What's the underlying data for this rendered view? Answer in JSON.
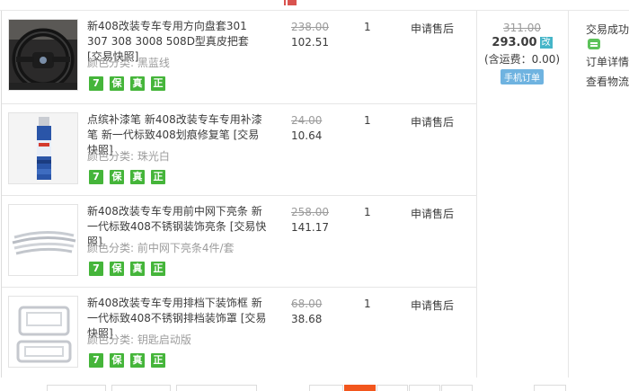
{
  "items": [
    {
      "title": "新408改装专车专用方向盘套301 307 308 3008 508D型真皮把套",
      "snapshot": "[交易快照]",
      "spec_label": "颜色分类:",
      "spec_value": "黑蓝线",
      "original_price": "238.00",
      "price": "102.51",
      "qty": "1",
      "after_sale": "申请售后",
      "thumb_icon": "steering-wheel-cover-image"
    },
    {
      "title": "点缤补漆笔 新408改装专车专用补漆笔 新一代标致408划痕修复笔",
      "snapshot": "[交易快照]",
      "spec_label": "颜色分类:",
      "spec_value": "珠光白",
      "original_price": "24.00",
      "price": "10.64",
      "qty": "1",
      "after_sale": "申请售后",
      "thumb_icon": "touch-up-paint-pen-image"
    },
    {
      "title": "新408改装专车专用前中网下亮条 新一代标致408不锈钢装饰亮条",
      "snapshot": "[交易快照]",
      "spec_label": "颜色分类:",
      "spec_value": "前中网下亮条4件/套",
      "original_price": "258.00",
      "price": "141.17",
      "qty": "1",
      "after_sale": "申请售后",
      "thumb_icon": "chrome-trim-strips-image"
    },
    {
      "title": "新408改装专车专用排档下装饰框 新一代标致408不锈钢排档装饰罩",
      "snapshot": "[交易快照]",
      "spec_label": "颜色分类:",
      "spec_value": "钥匙启动版",
      "original_price": "68.00",
      "price": "38.68",
      "qty": "1",
      "after_sale": "申请售后",
      "thumb_icon": "gear-shift-frame-image"
    }
  ],
  "badges": [
    "7",
    "保",
    "真",
    "正"
  ],
  "badge_icons": [
    "seven-day-return-icon",
    "guarantee-icon",
    "genuine-icon",
    "authentic-icon"
  ],
  "total": {
    "original": "311.00",
    "amount": "293.00",
    "modified_tag": "改",
    "shipping": "(含运费：0.00)",
    "mobile_order": "手机订单"
  },
  "status": {
    "state": "交易成功",
    "chat_icon": "wangwang-chat-icon",
    "order_detail": "订单详情",
    "view_logistics": "查看物流"
  },
  "colors": {
    "badge_green": "#45b53a",
    "modified_blue": "#45b5c8",
    "mobile_blue": "#6fb3e0",
    "pager_active": "#f2561d",
    "strike_gray": "#9c9c9c"
  }
}
